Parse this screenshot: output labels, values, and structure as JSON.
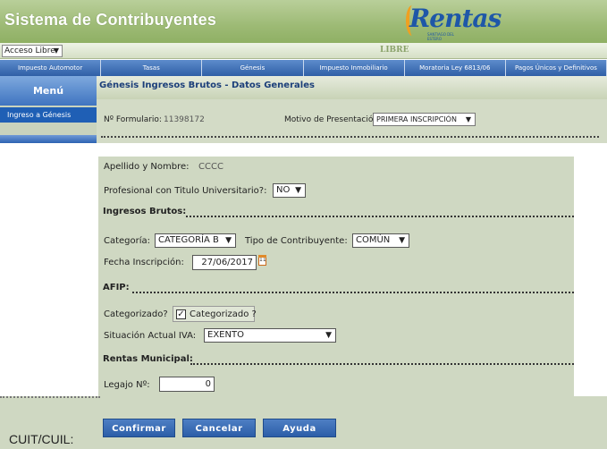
{
  "app": {
    "title": "Sistema de Contribuyentes",
    "logo_text": "Rentas",
    "logo_subtext": "SANTIAGO DEL ESTERO"
  },
  "statusbar": {
    "access_value": "Acceso Libre",
    "mode_label": "LIBRE"
  },
  "menu": [
    "Impuesto Automotor",
    "Tasas",
    "Génesis",
    "Impuesto Inmobiliario",
    "Moratoria Ley 6813/06",
    "Pagos Únicos y Definitivos"
  ],
  "sidebar": {
    "title": "Menú",
    "item": "Ingreso a Génesis"
  },
  "main": {
    "title": "Génesis Ingresos Brutos - Datos Generales",
    "form_number_label": "Nº Formulario:",
    "form_number_value": "11398172",
    "motivo_label": "Motivo de Presentación:",
    "motivo_value": "PRIMERA INSCRIPCIÓN"
  },
  "form": {
    "nombre_label": "Apellido y Nombre:",
    "nombre_value": "CCCC",
    "profesional_label": "Profesional con Titulo Universitario?:",
    "profesional_value": "NO",
    "ingresos_section": "Ingresos Brutos:",
    "categoria_label": "Categoría:",
    "categoria_value": "CATEGORÍA B",
    "tipo_label": "Tipo de Contribuyente:",
    "tipo_value": "COMÚN",
    "fecha_label": "Fecha Inscripción:",
    "fecha_value": "27/06/2017",
    "calendar_day": "11",
    "afip_section": "AFIP:",
    "categorizado_label": "Categorizado?",
    "categorizado_checkbox_label": "Categorizado ?",
    "categorizado_checked": true,
    "iva_label": "Situación Actual IVA:",
    "iva_value": "EXENTO",
    "rentas_section": "Rentas Municipal:",
    "legajo_label": "Legajo Nº:",
    "legajo_value": "0"
  },
  "footer": {
    "cuit_label": "CUIT/CUIL:",
    "confirm_label": "Confirmar",
    "cancel_label": "Cancelar",
    "help_label": "Ayuda"
  },
  "colors": {
    "header_green": "#9dba75",
    "nav_blue": "#2f5fa6",
    "panel_bg": "#cfd8c2",
    "logo_blue": "#1e57a8",
    "logo_orange": "#f0a020"
  }
}
